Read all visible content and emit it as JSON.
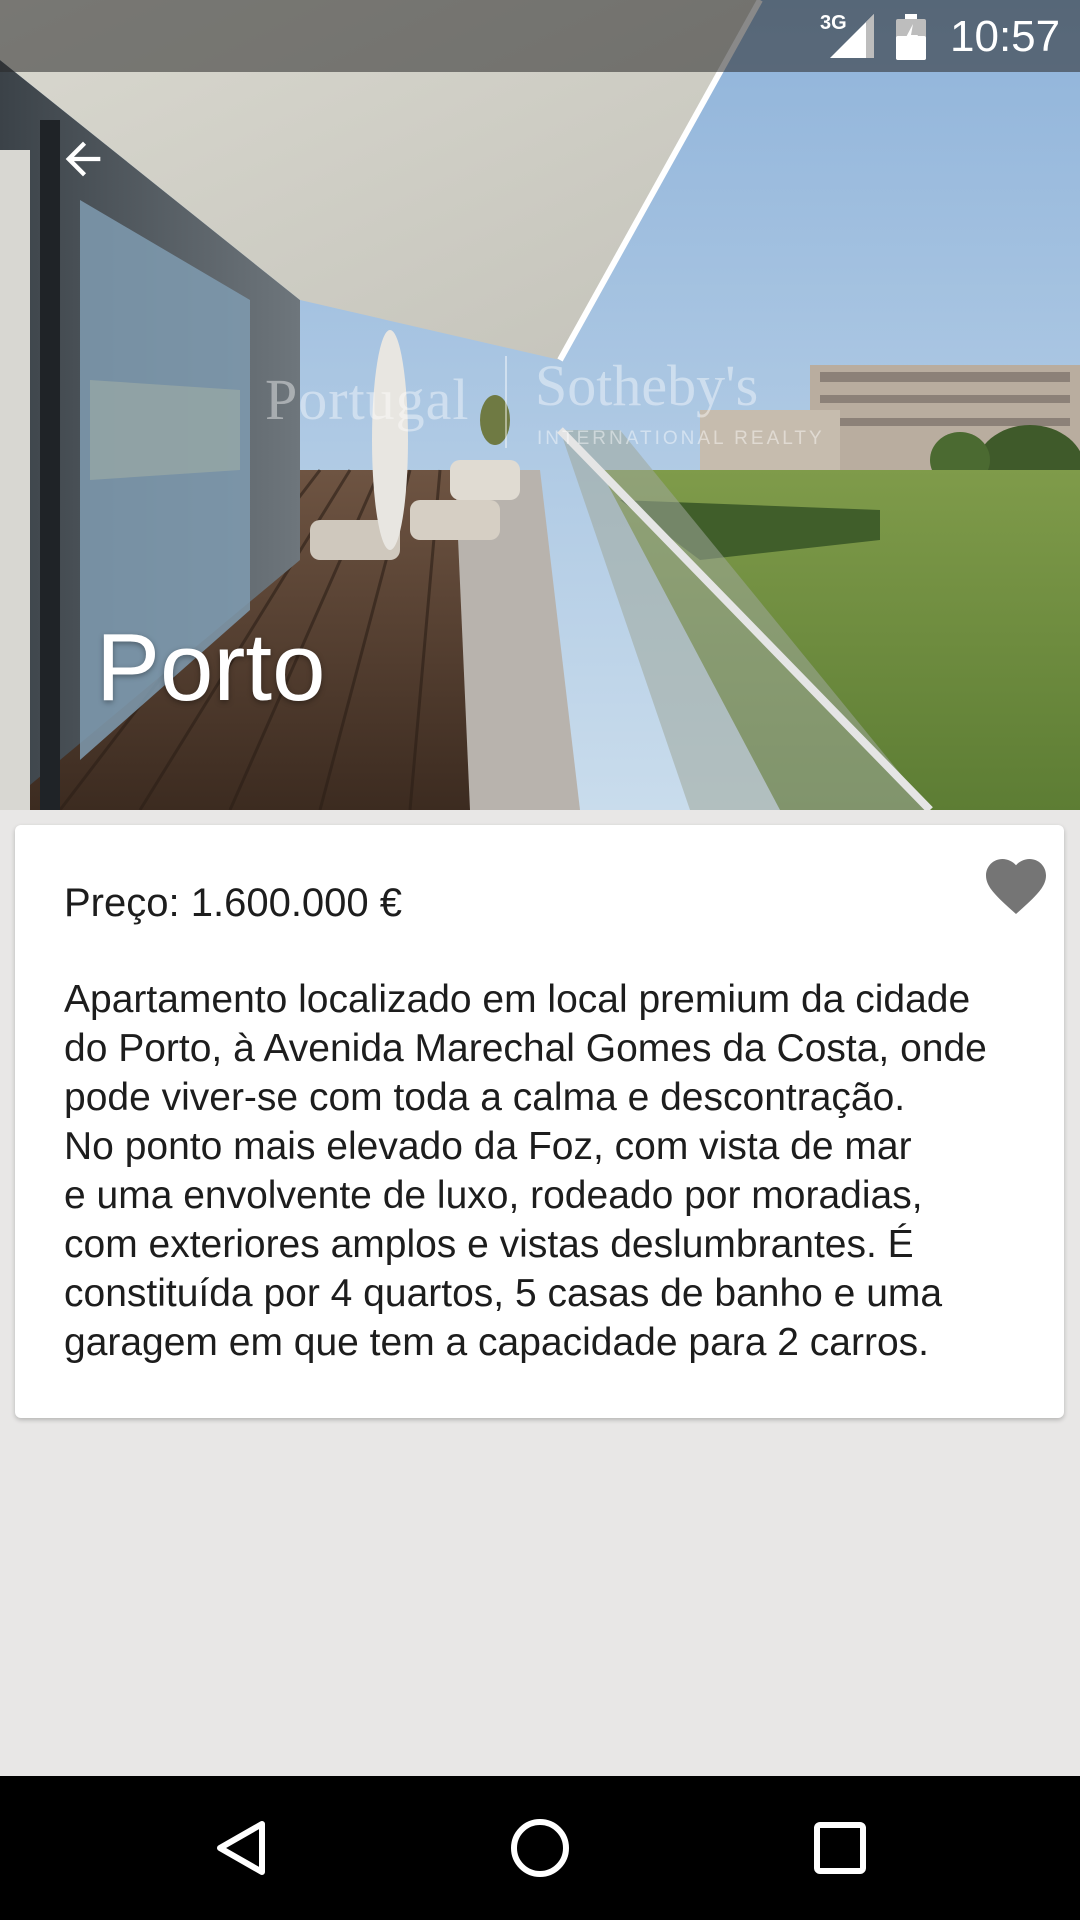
{
  "status_bar": {
    "network_type": "3G",
    "time": "10:57",
    "signal_icon": "cell-signal-icon",
    "battery_icon": "battery-charging-icon"
  },
  "hero": {
    "title": "Porto",
    "back_icon": "arrow-back-icon",
    "watermark": {
      "left": "Portugal",
      "right": "Sotheby's",
      "sub": "INTERNATIONAL REALTY"
    }
  },
  "details": {
    "price": "Preço: 1.600.000 €",
    "description": "Apartamento localizado em local premium da cidade\ndo Porto, à Avenida Marechal Gomes da Costa, onde\npode viver-se com toda a calma e descontração.\nNo ponto mais elevado da Foz, com vista de mar\ne uma envolvente de luxo, rodeado por moradias,\ncom exteriores amplos e vistas deslumbrantes. É\nconstituída por 4 quartos, 5 casas de banho e uma\ngaragem em que tem a capacidade para 2 carros.",
    "favorite_icon": "heart-icon"
  },
  "nav_bar": {
    "back_icon": "nav-back-icon",
    "home_icon": "nav-home-icon",
    "recents_icon": "nav-recents-icon"
  },
  "colors": {
    "background": "#e8e7e6",
    "card": "#ffffff",
    "heart": "#757575",
    "nav_bar": "#000000"
  }
}
